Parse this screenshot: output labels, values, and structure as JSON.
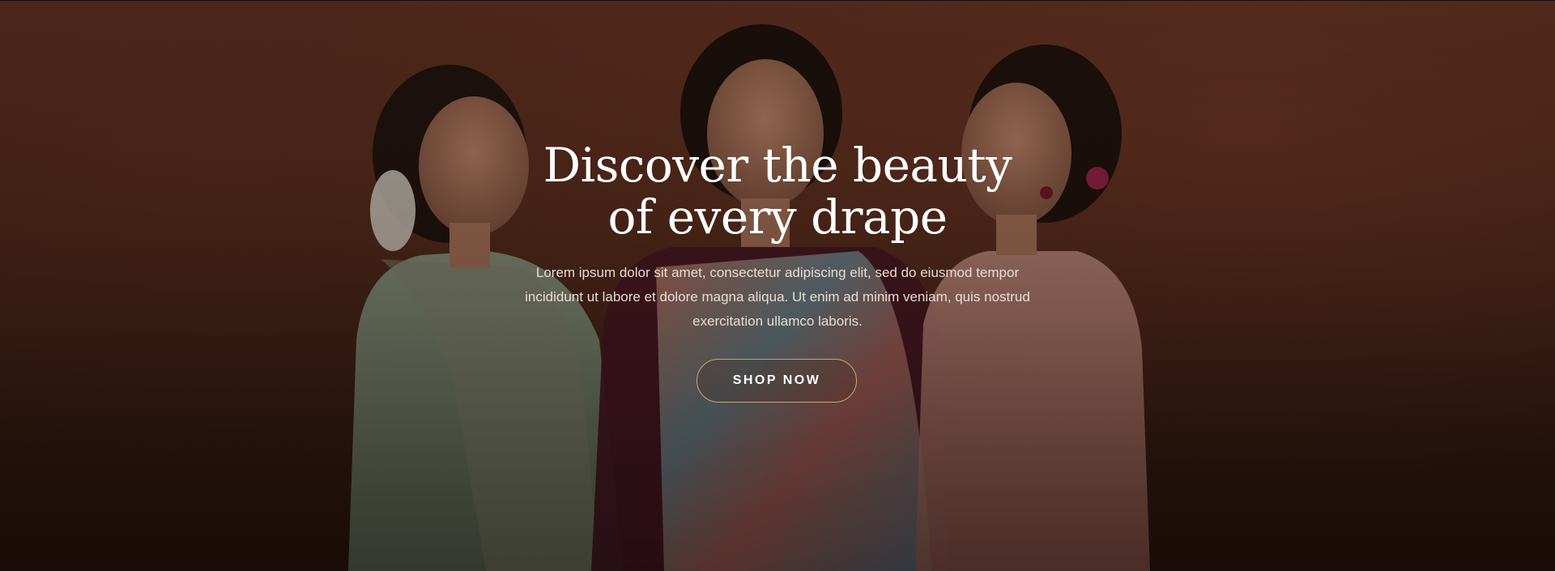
{
  "hero": {
    "headline_line1": "Discover the beauty",
    "headline_line2": "of every drape",
    "description": "Lorem ipsum dolor sit amet, consectetur adipiscing elit, sed do eiusmod tempor incididunt ut labore et dolore magna aliqua. Ut enim ad minim veniam, quis nostrud exercitation ullamco laboris.",
    "cta_label": "SHOP NOW",
    "colors": {
      "background": "#4a2619",
      "headline": "#ffffff",
      "description": "#e8dcd4",
      "button_border": "#c9a777"
    }
  }
}
